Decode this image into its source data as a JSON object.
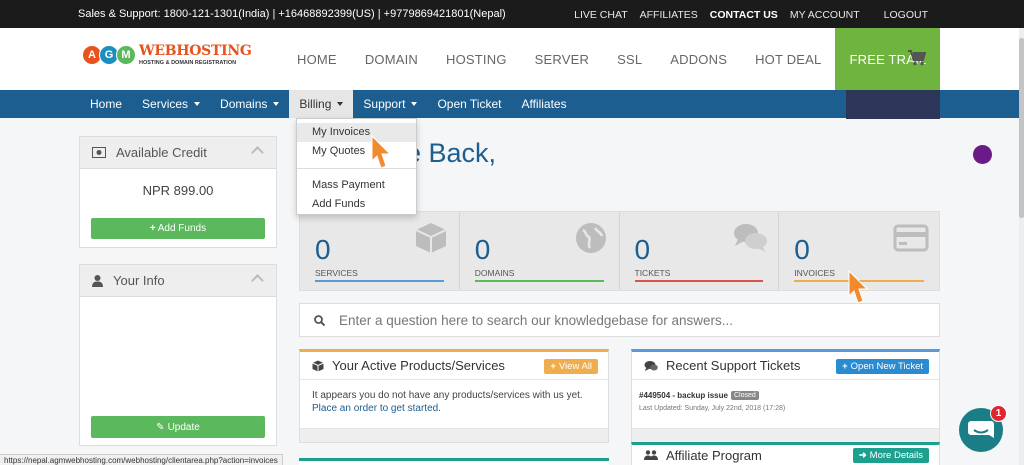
{
  "topbar": {
    "support": "Sales & Support: 1800-121-1301(India) | +16468892399(US) | +9779869421801(Nepal)",
    "links": [
      "LIVE CHAT",
      "AFFILIATES",
      "CONTACT US",
      "MY ACCOUNT",
      "LOGOUT"
    ]
  },
  "logo": {
    "letters": [
      "A",
      "G",
      "M"
    ],
    "brand": "WEBHOSTING",
    "tagline": "HOSTING & DOMAIN REGISTRATION"
  },
  "mainnav": {
    "home": "HOME",
    "domain": "DOMAIN",
    "hosting": "HOSTING",
    "server": "SERVER",
    "ssl": "SSL",
    "addons": "ADDONS",
    "hotdeal": "HOT DEAL",
    "free": "FREE TRAIL"
  },
  "bluenav": {
    "home": "Home",
    "services": "Services",
    "domains": "Domains",
    "billing": "Billing",
    "support": "Support",
    "open_ticket": "Open Ticket",
    "affiliates": "Affiliates"
  },
  "dropdown": {
    "my_invoices": "My Invoices",
    "my_quotes": "My Quotes",
    "mass_payment": "Mass Payment",
    "add_funds": "Add Funds"
  },
  "sidebar": {
    "credit_title": "Available Credit",
    "credit_value": "NPR 899.00",
    "add_funds": "Add Funds",
    "info_title": "Your Info",
    "update": "Update"
  },
  "welcome": "e Back,",
  "stats": [
    {
      "value": "0",
      "label": "SERVICES",
      "color": "#5a9bd5"
    },
    {
      "value": "0",
      "label": "DOMAINS",
      "color": "#5cb85c"
    },
    {
      "value": "0",
      "label": "TICKETS",
      "color": "#d9534f"
    },
    {
      "value": "0",
      "label": "INVOICES",
      "color": "#f0ad4e"
    }
  ],
  "kb": {
    "placeholder": "Enter a question here to search our knowledgebase for answers..."
  },
  "products": {
    "title": "Your Active Products/Services",
    "view_all": "View All",
    "empty": "It appears you do not have any products/services with us yet.",
    "link": "Place an order to get started."
  },
  "tickets": {
    "title": "Recent Support Tickets",
    "open_new": "Open New Ticket",
    "ref": "#449504 - backup issue",
    "status": "Closed",
    "updated": "Last Updated: Sunday, July 22nd, 2018 (17:28)"
  },
  "affiliate": {
    "title": "Affiliate Program",
    "more": "More Details"
  },
  "statusbar": "https://nepal.agmwebhosting.com/webhosting/clientarea.php?action=invoices",
  "chat": {
    "badge": "1"
  }
}
